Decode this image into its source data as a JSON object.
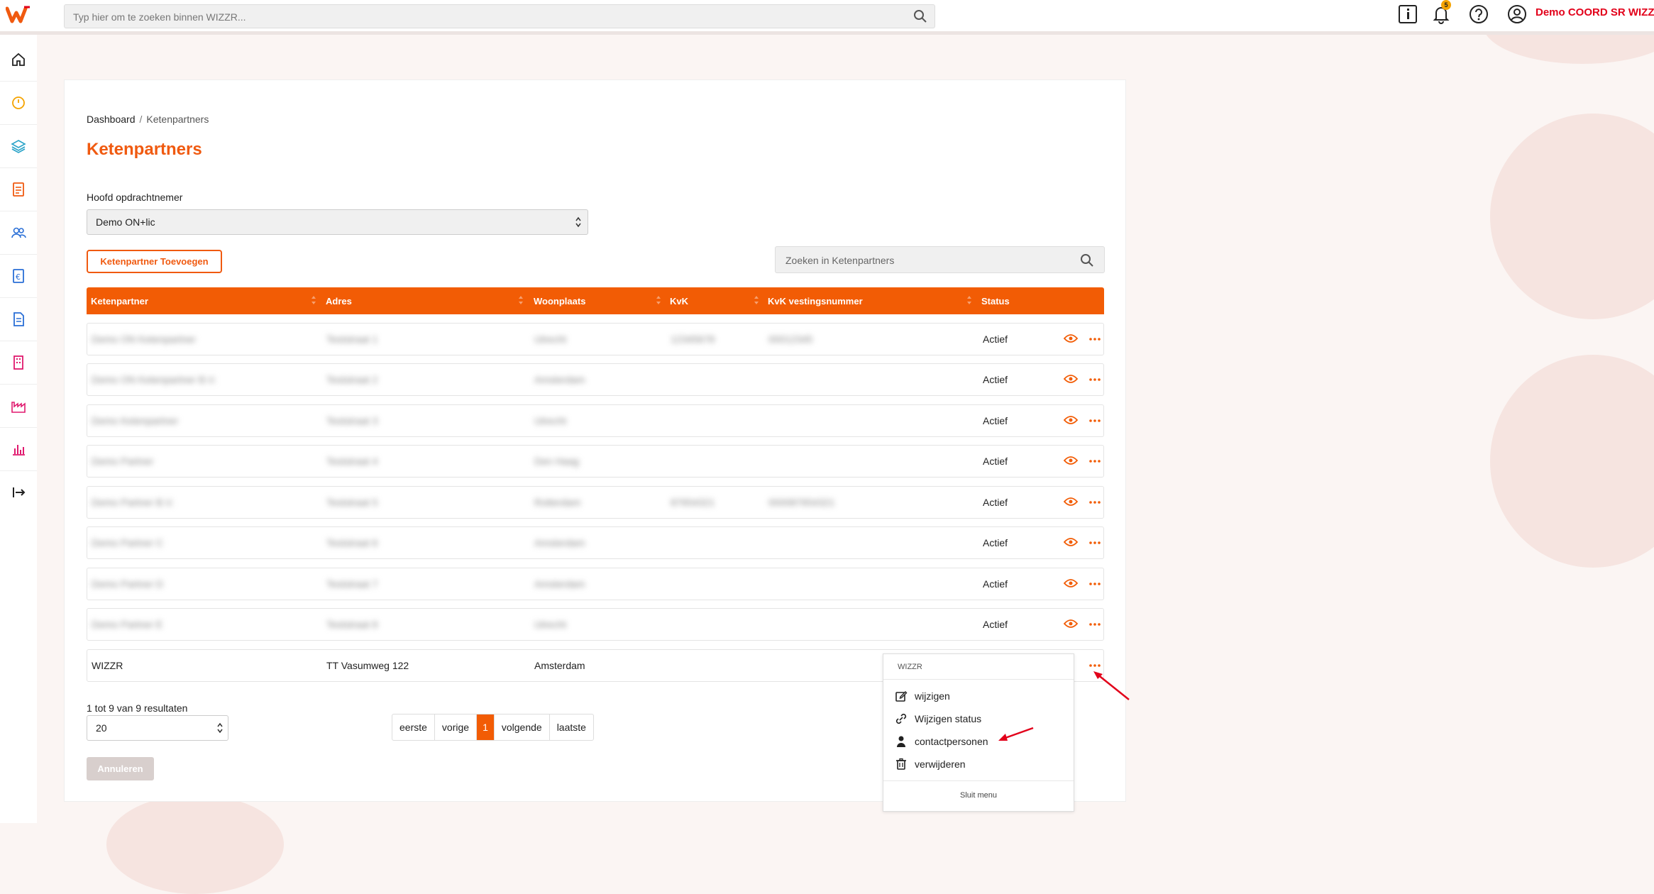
{
  "topbar": {
    "search_placeholder": "Typ hier om te zoeken binnen WIZZR...",
    "notification_count": "5",
    "user_name": "Demo COORD SR WIZZR"
  },
  "sidebar": {
    "items": [
      {
        "icon": "home-icon",
        "color": "#222222"
      },
      {
        "icon": "gauge-icon",
        "color": "#f5a300"
      },
      {
        "icon": "layers-icon",
        "color": "#29a3c8"
      },
      {
        "icon": "checklist-icon",
        "color": "#f05a10"
      },
      {
        "icon": "users-icon",
        "color": "#2a6fd6"
      },
      {
        "icon": "euro-document-icon",
        "color": "#2a6fd6"
      },
      {
        "icon": "document-icon",
        "color": "#2a6fd6"
      },
      {
        "icon": "building-icon",
        "color": "#e0196e"
      },
      {
        "icon": "factory-icon",
        "color": "#e0196e"
      },
      {
        "icon": "bar-chart-icon",
        "color": "#e0196e"
      },
      {
        "icon": "logout-icon",
        "color": "#222222"
      }
    ]
  },
  "breadcrumb": {
    "home": "Dashboard",
    "separator": "/",
    "current": "Ketenpartners"
  },
  "page_title": "Ketenpartners",
  "filter": {
    "label": "Hoofd opdrachtnemer",
    "value": "Demo ON+lic"
  },
  "add_button": "Ketenpartner Toevoegen",
  "table_search_placeholder": "Zoeken in Ketenpartners",
  "table": {
    "columns": [
      "Ketenpartner",
      "Adres",
      "Woonplaats",
      "KvK",
      "KvK vestingsnummer",
      "Status"
    ],
    "rows": [
      {
        "name": "Demo ON Ketenpartner",
        "address": "Teststraat 1",
        "city": "Utrecht",
        "kvk": "12345678",
        "vestiging": "00012345",
        "status": "Actief"
      },
      {
        "name": "Demo ON Ketenpartner B.V.",
        "address": "Teststraat 2",
        "city": "Amsterdam",
        "kvk": "",
        "vestiging": "",
        "status": "Actief"
      },
      {
        "name": "Demo Ketenpartner",
        "address": "Teststraat 3",
        "city": "Utrecht",
        "kvk": "",
        "vestiging": "",
        "status": "Actief"
      },
      {
        "name": "Demo Partner",
        "address": "Teststraat 4",
        "city": "Den Haag",
        "kvk": "",
        "vestiging": "",
        "status": "Actief"
      },
      {
        "name": "Demo Partner B.V.",
        "address": "Teststraat 5",
        "city": "Rotterdam",
        "kvk": "87654321",
        "vestiging": "000087654321",
        "status": "Actief"
      },
      {
        "name": "Demo Partner C",
        "address": "Teststraat 6",
        "city": "Amsterdam",
        "kvk": "",
        "vestiging": "",
        "status": "Actief"
      },
      {
        "name": "Demo Partner D",
        "address": "Teststraat 7",
        "city": "Amsterdam",
        "kvk": "",
        "vestiging": "",
        "status": "Actief"
      },
      {
        "name": "Demo Partner E",
        "address": "Teststraat 8",
        "city": "Utrecht",
        "kvk": "",
        "vestiging": "",
        "status": "Actief"
      },
      {
        "name": "WIZZR",
        "address": "TT Vasumweg 122",
        "city": "Amsterdam",
        "kvk": "",
        "vestiging": "",
        "status": ""
      }
    ]
  },
  "pagination": {
    "summary": "1 tot 9 van 9 resultaten",
    "page_size": "20",
    "first": "eerste",
    "previous": "vorige",
    "current": "1",
    "next": "volgende",
    "last": "laatste"
  },
  "cancel_button": "Annuleren",
  "context_menu": {
    "title": "WIZZR",
    "items": [
      {
        "label": "wijzigen",
        "icon": "edit-icon"
      },
      {
        "label": "Wijzigen status",
        "icon": "link-icon"
      },
      {
        "label": "contactpersonen",
        "icon": "person-icon"
      },
      {
        "label": "verwijderen",
        "icon": "trash-icon"
      }
    ],
    "close": "Sluit menu"
  },
  "colors": {
    "brand": "#f25c05",
    "title": "#f05a10",
    "user": "#e2001a"
  }
}
